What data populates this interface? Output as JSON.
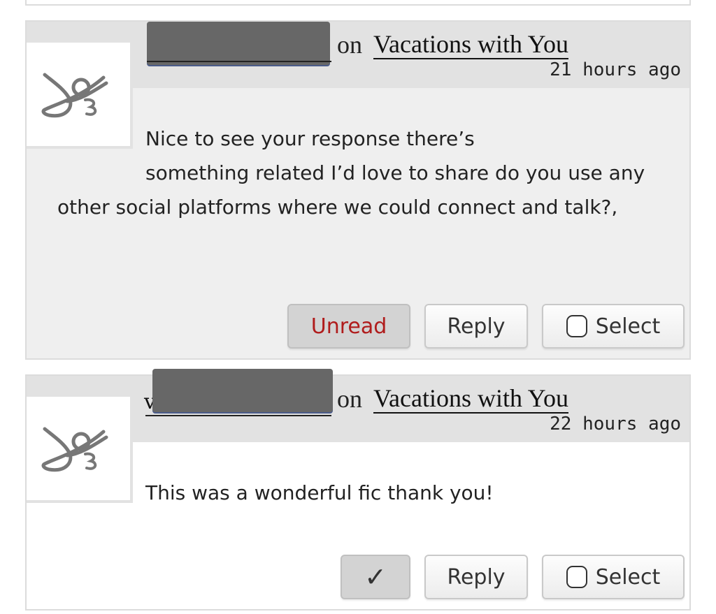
{
  "comments": [
    {
      "author_initial": "",
      "on_text": "on",
      "work_title": "Vacations with You",
      "timestamp": "21 hours ago",
      "body_first_line": "Nice to see your response there’s",
      "body_rest": "something related I’d love to share do you use any other social platforms where we could connect and talk?,",
      "buttons": {
        "unread": "Unread",
        "reply": "Reply",
        "select": "Select"
      },
      "state": "unread"
    },
    {
      "author_initial": "v",
      "on_text": "on",
      "work_title": "Vacations with You",
      "timestamp": "22 hours ago",
      "body_first_line": "This was a wonderful fic thank you!",
      "buttons": {
        "mark_read": "✓",
        "reply": "Reply",
        "select": "Select"
      },
      "state": "read"
    }
  ],
  "icons": {
    "avatar": "ao3-logo-icon",
    "checkbox": "checkbox-icon",
    "check": "checkmark-icon"
  },
  "colors": {
    "unread_text": "#b01c1c",
    "unread_bg": "#efefef",
    "header_bg": "#e2e2e2"
  }
}
